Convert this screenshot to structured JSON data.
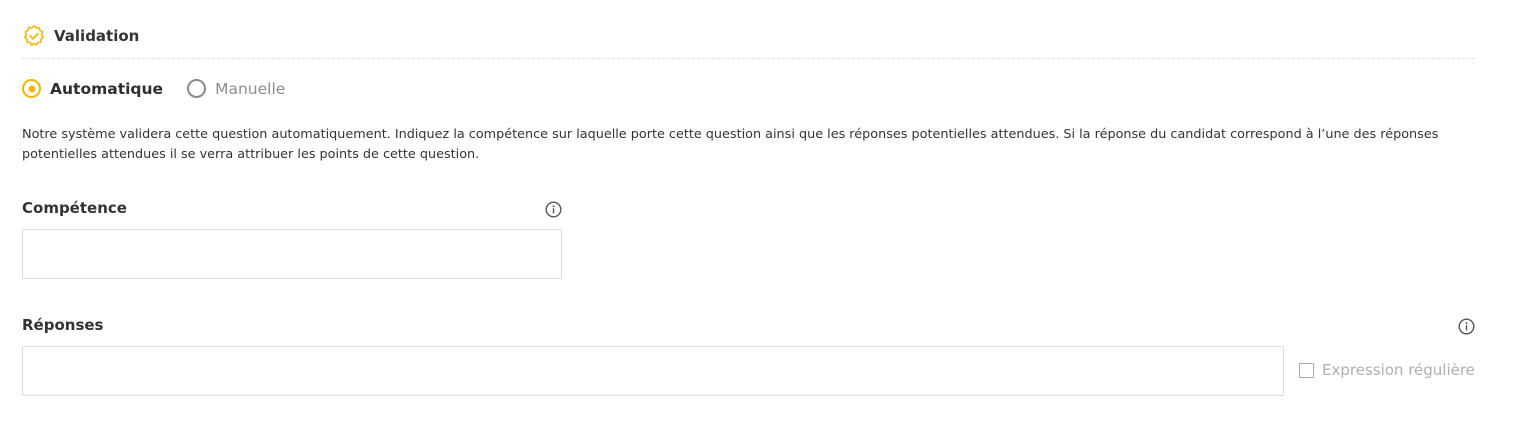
{
  "section": {
    "title": "Validation",
    "icon": "verified-badge-icon",
    "accent_color": "#f2b705"
  },
  "validation_mode": {
    "options": [
      {
        "label": "Automatique",
        "checked": true
      },
      {
        "label": "Manuelle",
        "checked": false
      }
    ]
  },
  "description": "Notre système validera cette question automatiquement. Indiquez la compétence sur laquelle porte cette question ainsi que les réponses potentielles attendues. Si la réponse du candidat correspond à l’une des réponses potentielles attendues il se verra attribuer les points de cette question.",
  "competence": {
    "label": "Compétence",
    "value": "",
    "info_icon": "info-icon"
  },
  "responses": {
    "label": "Réponses",
    "value": "",
    "info_icon": "info-icon",
    "regex_label": "Expression régulière",
    "regex_checked": false
  }
}
